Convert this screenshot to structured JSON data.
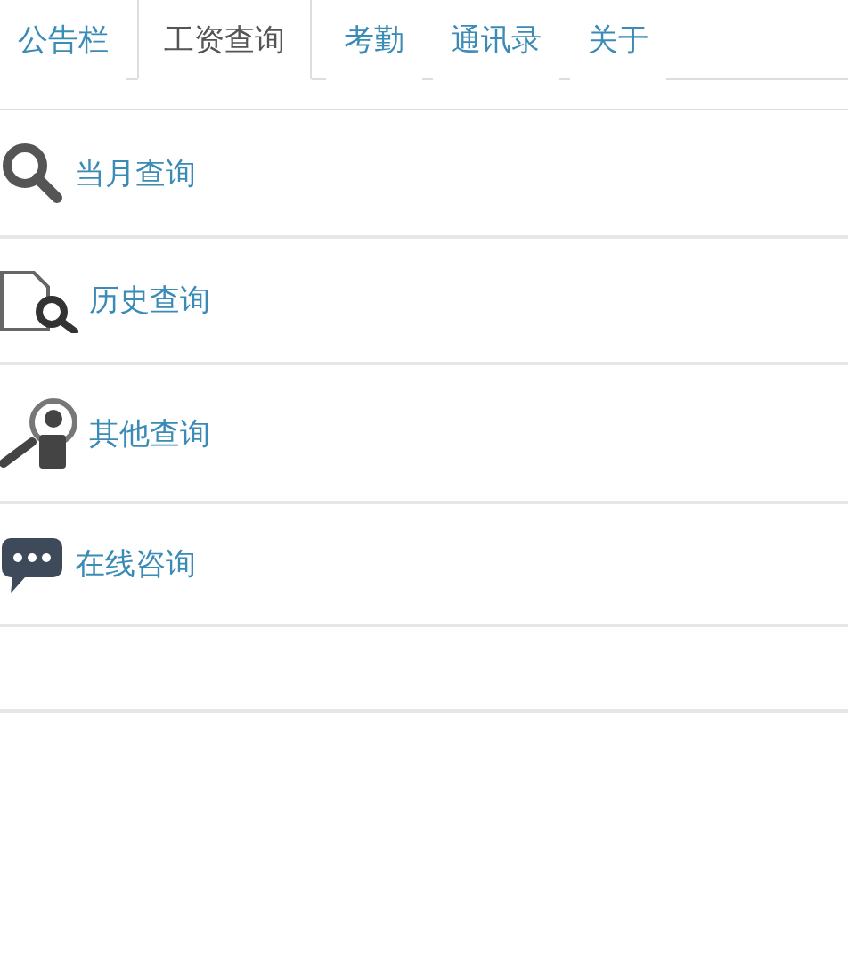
{
  "tabs": [
    {
      "label": "公告栏",
      "selected": false
    },
    {
      "label": "工资查询",
      "selected": true
    },
    {
      "label": "考勤",
      "selected": false
    },
    {
      "label": "通讯录",
      "selected": false
    },
    {
      "label": "关于",
      "selected": false
    }
  ],
  "menu": [
    {
      "label": "当月查询",
      "kind": "search"
    },
    {
      "label": "历史查询",
      "kind": "document"
    },
    {
      "label": "其他查询",
      "kind": "person"
    },
    {
      "label": "在线咨询",
      "kind": "chat"
    }
  ]
}
